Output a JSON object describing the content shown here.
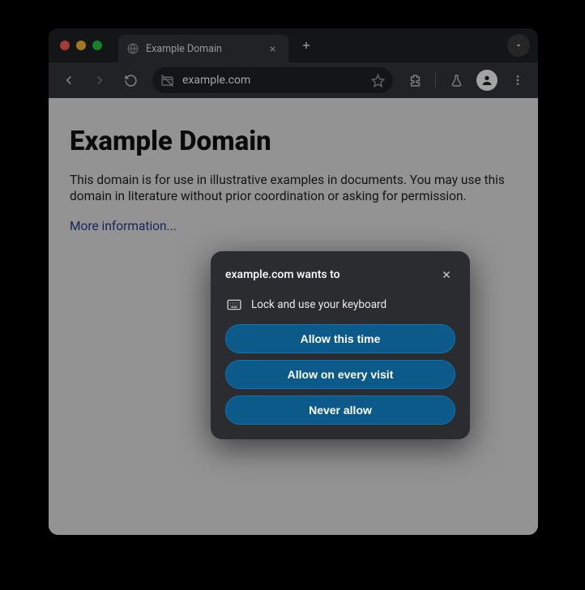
{
  "tab": {
    "title": "Example Domain"
  },
  "toolbar": {
    "url": "example.com"
  },
  "page": {
    "heading": "Example Domain",
    "paragraph": "This domain is for use in illustrative examples in documents. You may use this domain in literature without prior coordination or asking for permission.",
    "more_link": "More information..."
  },
  "dialog": {
    "title": "example.com wants to",
    "permission": "Lock and use your keyboard",
    "buttons": {
      "allow_once": "Allow this time",
      "allow_always": "Allow on every visit",
      "never": "Never allow"
    }
  }
}
